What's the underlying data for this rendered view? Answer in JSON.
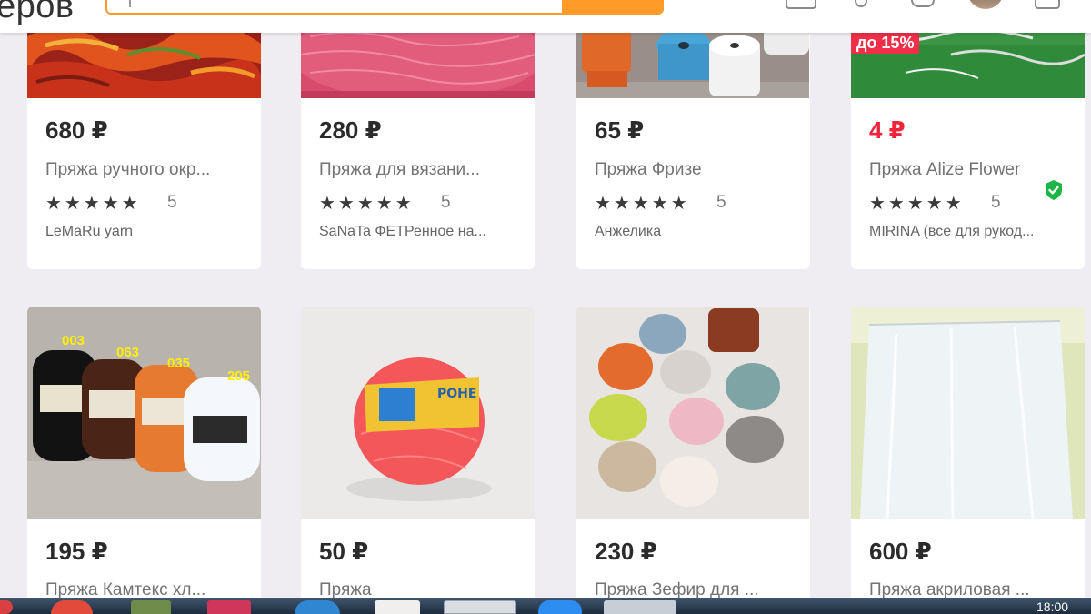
{
  "header": {
    "logo_text": "еров",
    "search_placeholder": "",
    "colors": {
      "accent": "#ff9c29"
    },
    "icons": [
      "orders-icon",
      "location-pin-icon",
      "notifications-bell-icon",
      "user-avatar",
      "cart-icon"
    ]
  },
  "products": [
    {
      "price": "680 ₽",
      "name": "Пряжа ручного окр...",
      "rating": "5",
      "stars": "★★★★★",
      "shop": "LeMaRu yarn",
      "discount": null,
      "price_color": "#2b2b2b",
      "verified": false
    },
    {
      "price": "280 ₽",
      "name": "Пряжа для вязани...",
      "rating": "5",
      "stars": "★★★★★",
      "shop": "SaNaTa ФЕТРенное на...",
      "discount": null,
      "price_color": "#2b2b2b",
      "verified": false
    },
    {
      "price": "65 ₽",
      "name": "Пряжа Фризе",
      "rating": "5",
      "stars": "★★★★★",
      "shop": "Анжелика",
      "discount": null,
      "price_color": "#2b2b2b",
      "verified": false
    },
    {
      "price": "4 ₽",
      "name": "Пряжа Alize Flower",
      "rating": "5",
      "stars": "★★★★★",
      "shop": "MIRINA (все для рукод...",
      "discount": "до 15%",
      "price_color": "#f0243a",
      "verified": true
    },
    {
      "price": "195 ₽",
      "name": "Пряжа Камтекс хл...",
      "image_labels": [
        "003",
        "063",
        "035",
        "205"
      ]
    },
    {
      "price": "50 ₽",
      "name": "Пряжа"
    },
    {
      "price": "230 ₽",
      "name": "Пряжа Зефир для ..."
    },
    {
      "price": "600 ₽",
      "name": "Пряжа акриловая ..."
    }
  ],
  "taskbar": {
    "clock": "18:00",
    "apps": [
      "chrome-icon",
      "app-icon",
      "kaspersky-icon",
      "browser-icon",
      "yandex-icon",
      "app-window-icon",
      "zoom-icon",
      "paint-icon"
    ]
  }
}
